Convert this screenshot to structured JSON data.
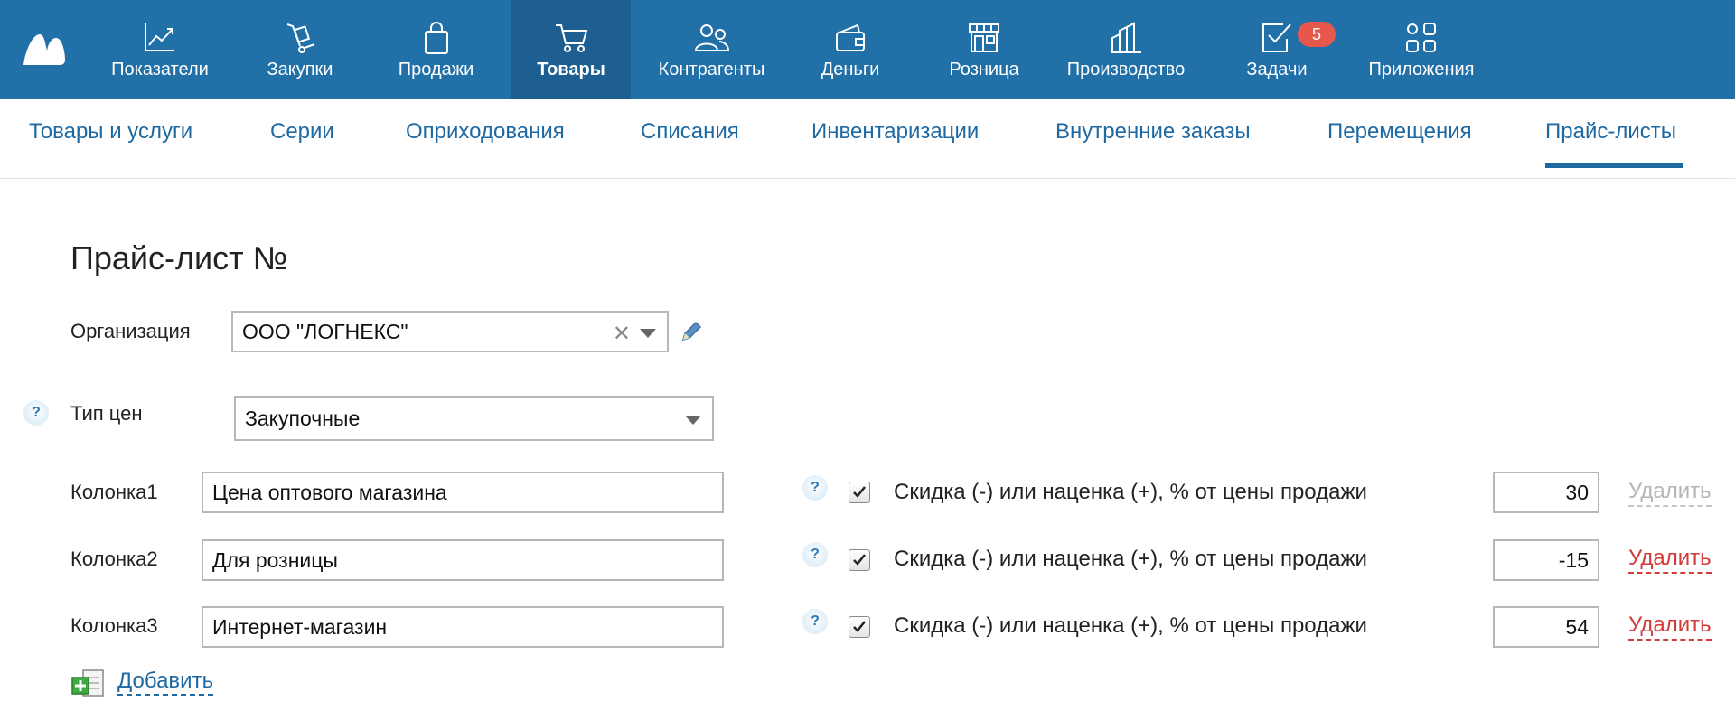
{
  "nav": {
    "items": [
      {
        "label": "Показатели",
        "icon": "chart-line-icon"
      },
      {
        "label": "Закупки",
        "icon": "hand-truck-icon"
      },
      {
        "label": "Продажи",
        "icon": "shopping-bag-icon"
      },
      {
        "label": "Товары",
        "icon": "shopping-cart-icon",
        "active": true
      },
      {
        "label": "Контрагенты",
        "icon": "people-icon"
      },
      {
        "label": "Деньги",
        "icon": "wallet-icon"
      },
      {
        "label": "Розница",
        "icon": "storefront-icon"
      },
      {
        "label": "Производство",
        "icon": "factory-icon"
      },
      {
        "label": "Задачи",
        "icon": "task-check-icon",
        "badge": "5"
      },
      {
        "label": "Приложения",
        "icon": "apps-grid-icon"
      }
    ]
  },
  "subnav": {
    "items": [
      {
        "label": "Товары и услуги"
      },
      {
        "label": "Серии"
      },
      {
        "label": "Оприходования"
      },
      {
        "label": "Списания"
      },
      {
        "label": "Инвентаризации"
      },
      {
        "label": "Внутренние заказы"
      },
      {
        "label": "Перемещения"
      },
      {
        "label": "Прайс-листы",
        "active": true
      }
    ]
  },
  "form": {
    "title": "Прайс-лист №",
    "organization": {
      "label": "Организация",
      "value": "ООО \"ЛОГНЕКС\""
    },
    "price_type": {
      "label": "Тип цен",
      "value": "Закупочные"
    },
    "columns": [
      {
        "label": "Колонка1",
        "value": "Цена оптового магазина",
        "checked": true,
        "markup_label": "Скидка (-) или наценка (+), % от цены продажи",
        "percent": "30",
        "delete_label": "Удалить",
        "delete_enabled": false
      },
      {
        "label": "Колонка2",
        "value": "Для розницы",
        "checked": true,
        "markup_label": "Скидка (-) или наценка (+), % от цены продажи",
        "percent": "-15",
        "delete_label": "Удалить",
        "delete_enabled": true
      },
      {
        "label": "Колонка3",
        "value": "Интернет-магазин",
        "checked": true,
        "markup_label": "Скидка (-) или наценка (+), % от цены продажи",
        "percent": "54",
        "delete_label": "Удалить",
        "delete_enabled": true
      }
    ],
    "add_label": "Добавить",
    "help_mark": "?"
  },
  "colors": {
    "topbar": "#2170a8",
    "topbar_active": "#1c5f90",
    "link": "#1f69a3",
    "danger": "#d33a3a",
    "badge": "#e8574c"
  }
}
